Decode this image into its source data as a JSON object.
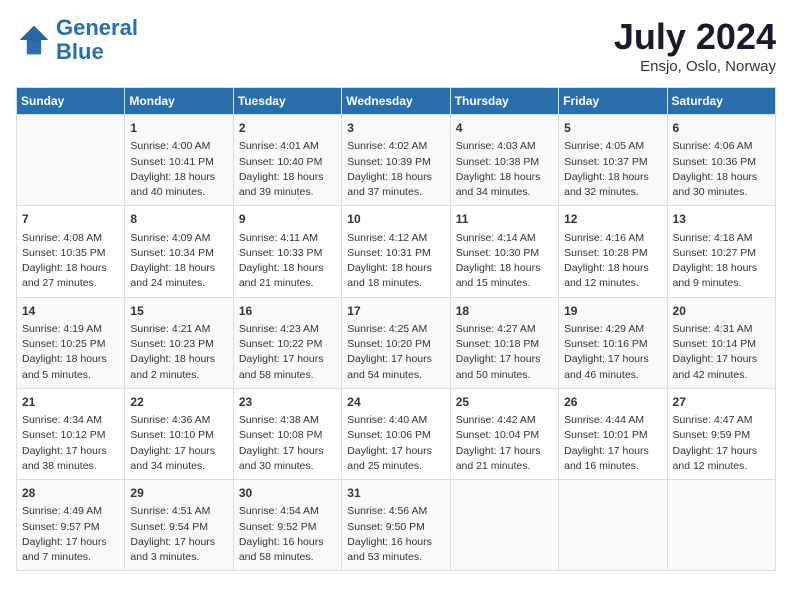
{
  "header": {
    "logo_line1": "General",
    "logo_line2": "Blue",
    "month": "July 2024",
    "location": "Ensjo, Oslo, Norway"
  },
  "weekdays": [
    "Sunday",
    "Monday",
    "Tuesday",
    "Wednesday",
    "Thursday",
    "Friday",
    "Saturday"
  ],
  "weeks": [
    [
      {
        "day": "",
        "info": ""
      },
      {
        "day": "1",
        "info": "Sunrise: 4:00 AM\nSunset: 10:41 PM\nDaylight: 18 hours\nand 40 minutes."
      },
      {
        "day": "2",
        "info": "Sunrise: 4:01 AM\nSunset: 10:40 PM\nDaylight: 18 hours\nand 39 minutes."
      },
      {
        "day": "3",
        "info": "Sunrise: 4:02 AM\nSunset: 10:39 PM\nDaylight: 18 hours\nand 37 minutes."
      },
      {
        "day": "4",
        "info": "Sunrise: 4:03 AM\nSunset: 10:38 PM\nDaylight: 18 hours\nand 34 minutes."
      },
      {
        "day": "5",
        "info": "Sunrise: 4:05 AM\nSunset: 10:37 PM\nDaylight: 18 hours\nand 32 minutes."
      },
      {
        "day": "6",
        "info": "Sunrise: 4:06 AM\nSunset: 10:36 PM\nDaylight: 18 hours\nand 30 minutes."
      }
    ],
    [
      {
        "day": "7",
        "info": "Sunrise: 4:08 AM\nSunset: 10:35 PM\nDaylight: 18 hours\nand 27 minutes."
      },
      {
        "day": "8",
        "info": "Sunrise: 4:09 AM\nSunset: 10:34 PM\nDaylight: 18 hours\nand 24 minutes."
      },
      {
        "day": "9",
        "info": "Sunrise: 4:11 AM\nSunset: 10:33 PM\nDaylight: 18 hours\nand 21 minutes."
      },
      {
        "day": "10",
        "info": "Sunrise: 4:12 AM\nSunset: 10:31 PM\nDaylight: 18 hours\nand 18 minutes."
      },
      {
        "day": "11",
        "info": "Sunrise: 4:14 AM\nSunset: 10:30 PM\nDaylight: 18 hours\nand 15 minutes."
      },
      {
        "day": "12",
        "info": "Sunrise: 4:16 AM\nSunset: 10:28 PM\nDaylight: 18 hours\nand 12 minutes."
      },
      {
        "day": "13",
        "info": "Sunrise: 4:18 AM\nSunset: 10:27 PM\nDaylight: 18 hours\nand 9 minutes."
      }
    ],
    [
      {
        "day": "14",
        "info": "Sunrise: 4:19 AM\nSunset: 10:25 PM\nDaylight: 18 hours\nand 5 minutes."
      },
      {
        "day": "15",
        "info": "Sunrise: 4:21 AM\nSunset: 10:23 PM\nDaylight: 18 hours\nand 2 minutes."
      },
      {
        "day": "16",
        "info": "Sunrise: 4:23 AM\nSunset: 10:22 PM\nDaylight: 17 hours\nand 58 minutes."
      },
      {
        "day": "17",
        "info": "Sunrise: 4:25 AM\nSunset: 10:20 PM\nDaylight: 17 hours\nand 54 minutes."
      },
      {
        "day": "18",
        "info": "Sunrise: 4:27 AM\nSunset: 10:18 PM\nDaylight: 17 hours\nand 50 minutes."
      },
      {
        "day": "19",
        "info": "Sunrise: 4:29 AM\nSunset: 10:16 PM\nDaylight: 17 hours\nand 46 minutes."
      },
      {
        "day": "20",
        "info": "Sunrise: 4:31 AM\nSunset: 10:14 PM\nDaylight: 17 hours\nand 42 minutes."
      }
    ],
    [
      {
        "day": "21",
        "info": "Sunrise: 4:34 AM\nSunset: 10:12 PM\nDaylight: 17 hours\nand 38 minutes."
      },
      {
        "day": "22",
        "info": "Sunrise: 4:36 AM\nSunset: 10:10 PM\nDaylight: 17 hours\nand 34 minutes."
      },
      {
        "day": "23",
        "info": "Sunrise: 4:38 AM\nSunset: 10:08 PM\nDaylight: 17 hours\nand 30 minutes."
      },
      {
        "day": "24",
        "info": "Sunrise: 4:40 AM\nSunset: 10:06 PM\nDaylight: 17 hours\nand 25 minutes."
      },
      {
        "day": "25",
        "info": "Sunrise: 4:42 AM\nSunset: 10:04 PM\nDaylight: 17 hours\nand 21 minutes."
      },
      {
        "day": "26",
        "info": "Sunrise: 4:44 AM\nSunset: 10:01 PM\nDaylight: 17 hours\nand 16 minutes."
      },
      {
        "day": "27",
        "info": "Sunrise: 4:47 AM\nSunset: 9:59 PM\nDaylight: 17 hours\nand 12 minutes."
      }
    ],
    [
      {
        "day": "28",
        "info": "Sunrise: 4:49 AM\nSunset: 9:57 PM\nDaylight: 17 hours\nand 7 minutes."
      },
      {
        "day": "29",
        "info": "Sunrise: 4:51 AM\nSunset: 9:54 PM\nDaylight: 17 hours\nand 3 minutes."
      },
      {
        "day": "30",
        "info": "Sunrise: 4:54 AM\nSunset: 9:52 PM\nDaylight: 16 hours\nand 58 minutes."
      },
      {
        "day": "31",
        "info": "Sunrise: 4:56 AM\nSunset: 9:50 PM\nDaylight: 16 hours\nand 53 minutes."
      },
      {
        "day": "",
        "info": ""
      },
      {
        "day": "",
        "info": ""
      },
      {
        "day": "",
        "info": ""
      }
    ]
  ]
}
